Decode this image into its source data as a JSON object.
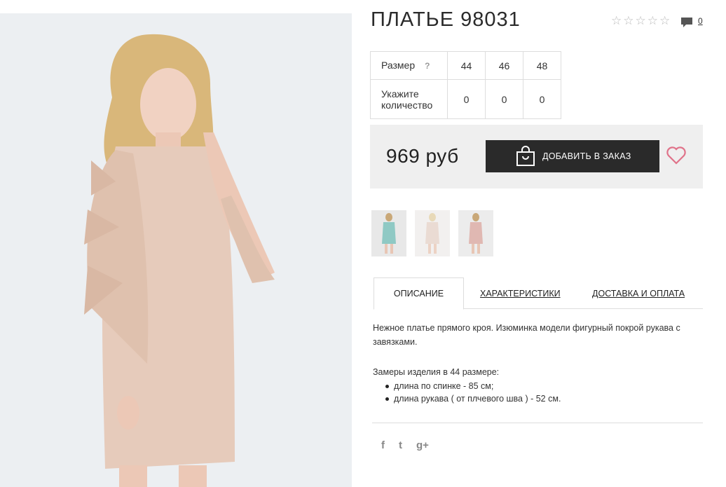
{
  "product": {
    "title": "ПЛАТЬЕ 98031",
    "rating_stars": 5,
    "comments_count": "0"
  },
  "sizes": {
    "size_label": "Размер",
    "help": "?",
    "values": [
      "44",
      "46",
      "48"
    ],
    "qty_label": "Укажите количество",
    "qty_values": [
      "0",
      "0",
      "0"
    ]
  },
  "buy": {
    "price": "969 руб",
    "add_label": "ДОБАВИТЬ В ЗАКАЗ"
  },
  "thumbnails": [
    {
      "color": "#8fc9c4"
    },
    {
      "color": "#eadbd3"
    },
    {
      "color": "#e0b8b2"
    }
  ],
  "tabs": {
    "description": "ОПИСАНИЕ",
    "characteristics": "ХАРАКТЕРИСТИКИ",
    "delivery": "ДОСТАВКА И ОПЛАТА"
  },
  "description": {
    "text": "Нежное платье прямого кроя. Изюминка модели фигурный покрой рукава с завязками.",
    "measures_title": "Замеры изделия в 44 размере:",
    "measures": [
      "длина по спинке - 85 см;",
      "длина рукава ( от плчевого шва ) - 52 см."
    ]
  },
  "social": {
    "facebook": "f",
    "twitter": "t",
    "google": "g+"
  },
  "colors": {
    "dress": "#e6cbbb",
    "button": "#2a2a2a",
    "heart": "#e0738a"
  }
}
